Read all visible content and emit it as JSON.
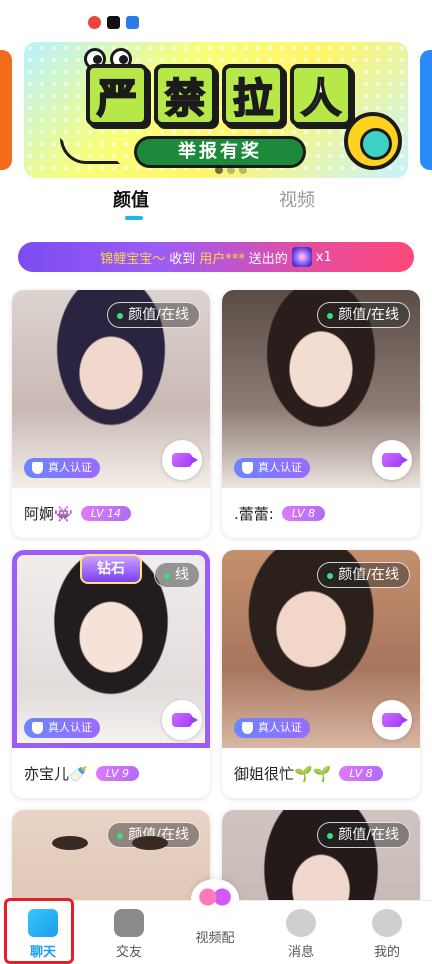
{
  "status_icons": [
    "weibo-icon",
    "tiktok-icon",
    "app-icon"
  ],
  "banner": {
    "title_chars": [
      "严",
      "禁",
      "拉",
      "人"
    ],
    "subtitle": "举报有奖"
  },
  "tabs": [
    {
      "label": "颜值",
      "active": true
    },
    {
      "label": "视频",
      "active": false
    }
  ],
  "gift_bar": {
    "sender": "锦鲤宝宝～",
    "received": "收到",
    "user": "用户***",
    "sent": "送出的",
    "count": "x1"
  },
  "cards": [
    {
      "status": "颜值/在线",
      "verified": "真人认证",
      "name": "阿婀👾",
      "level": "LV 14"
    },
    {
      "status": "颜值/在线",
      "verified": "真人认证",
      "name": ".蕾蕾:",
      "level": "LV 8"
    },
    {
      "status": "线",
      "verified": "真人认证",
      "name": "亦宝儿🍼",
      "level": "LV 9",
      "frame_label": "钻石"
    },
    {
      "status": "颜值/在线",
      "verified": "真人认证",
      "name": "御姐很忙🌱🌱",
      "level": "LV 8"
    },
    {
      "status": "颜值/在线"
    },
    {
      "status": "颜值/在线"
    }
  ],
  "bottom_nav": [
    {
      "label": "聊天",
      "icon": "video-camera-icon",
      "active": true
    },
    {
      "label": "交友",
      "icon": "heart-box-icon"
    },
    {
      "label": "视频配",
      "icon": "hearts-icon"
    },
    {
      "label": "消息",
      "icon": "chat-bubble-icon"
    },
    {
      "label": "我的",
      "icon": "person-icon"
    }
  ],
  "colors": {
    "accent": "#18b8f0",
    "gift_start": "#7c4cf0",
    "gift_end": "#ff4a7a",
    "highlight": "#e51f2a"
  }
}
